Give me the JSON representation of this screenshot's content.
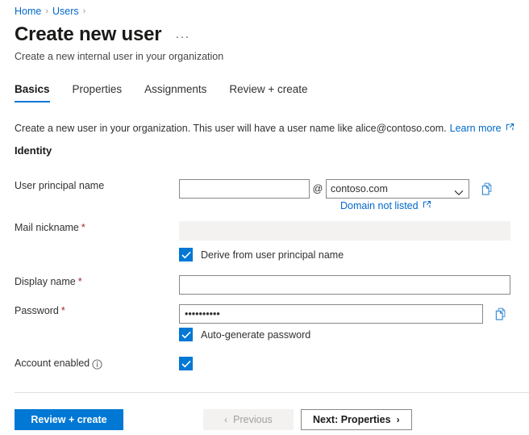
{
  "breadcrumb": {
    "items": [
      {
        "label": "Home"
      },
      {
        "label": "Users"
      }
    ],
    "separator": "›"
  },
  "header": {
    "title": "Create new user",
    "more_label": "···",
    "subtitle": "Create a new internal user in your organization"
  },
  "tabs": [
    {
      "label": "Basics",
      "active": true
    },
    {
      "label": "Properties",
      "active": false
    },
    {
      "label": "Assignments",
      "active": false
    },
    {
      "label": "Review + create",
      "active": false
    }
  ],
  "intro": {
    "text": "Create a new user in your organization. This user will have a user name like alice@contoso.com.",
    "link_label": "Learn more"
  },
  "section": {
    "identity_heading": "Identity"
  },
  "form": {
    "user_principal_name": {
      "label": "User principal name",
      "value": "",
      "placeholder": "",
      "at": "@",
      "domain_selected": "contoso.com",
      "domain_options": [
        "contoso.com"
      ],
      "sub_link_label": "Domain not listed",
      "copy_tooltip": "Copy"
    },
    "mail_nickname": {
      "label": "Mail nickname",
      "required_mark": "*",
      "value": "",
      "derive_checkbox_label": "Derive from user principal name",
      "derive_checked": true
    },
    "display_name": {
      "label": "Display name",
      "required_mark": "*",
      "value": "",
      "placeholder": ""
    },
    "password": {
      "label": "Password",
      "required_mark": "*",
      "value": "••••••••••",
      "auto_generate_label": "Auto-generate password",
      "auto_generate_checked": true,
      "copy_tooltip": "Copy"
    },
    "account_enabled": {
      "label": "Account enabled",
      "checked": true,
      "info_tooltip": "Info"
    }
  },
  "footer": {
    "review_create_label": "Review + create",
    "previous_label": "Previous",
    "previous_disabled": true,
    "next_label": "Next: Properties",
    "prev_arrow": "‹",
    "next_arrow": "›"
  },
  "colors": {
    "accent": "#0078d4",
    "link": "#0068c9",
    "required": "#a4262c",
    "disabled_bg": "#f3f2f1",
    "divider": "#e1dfdd"
  }
}
